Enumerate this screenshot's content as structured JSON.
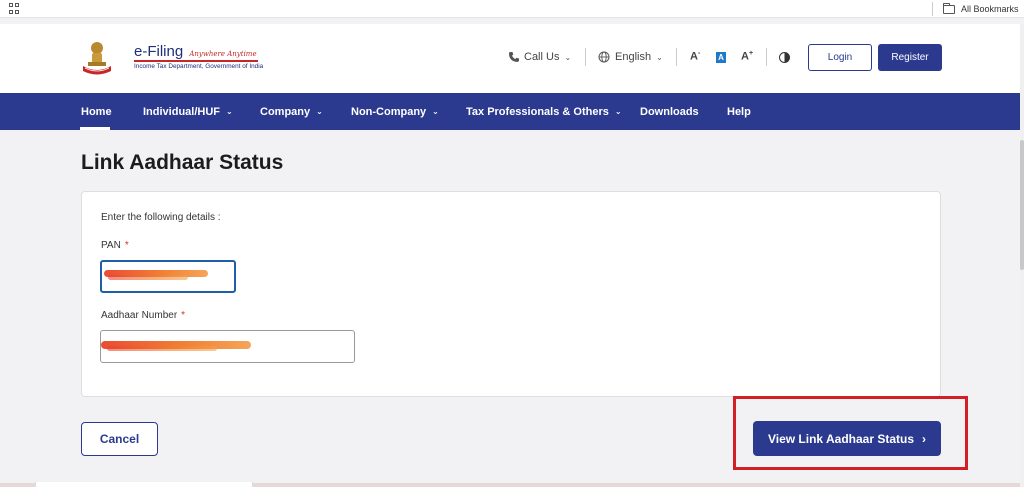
{
  "bookmarks_bar": {
    "all_bookmarks": "All Bookmarks"
  },
  "header": {
    "brand": "e-Filing",
    "tagline": "Anywhere Anytime",
    "department": "Income Tax Department, Government of India",
    "call_us": "Call Us",
    "language": "English",
    "font_decrease": "A",
    "font_default": "A",
    "font_increase": "A",
    "login": "Login",
    "register": "Register"
  },
  "nav": {
    "items": [
      {
        "label": "Home",
        "active": true
      },
      {
        "label": "Individual/HUF",
        "dropdown": true
      },
      {
        "label": "Company",
        "dropdown": true
      },
      {
        "label": "Non-Company",
        "dropdown": true
      },
      {
        "label": "Tax Professionals & Others",
        "dropdown": true
      },
      {
        "label": "Downloads"
      },
      {
        "label": "Help"
      }
    ]
  },
  "page": {
    "title": "Link Aadhaar Status",
    "instructions": "Enter the following details :",
    "pan_label": "PAN",
    "aadhaar_label": "Aadhaar Number",
    "required_mark": "*",
    "pan_value": "",
    "aadhaar_value": ""
  },
  "actions": {
    "cancel": "Cancel",
    "view_status": "View Link Aadhaar Status"
  },
  "colors": {
    "brand_blue": "#2b3a8f",
    "highlight_red": "#d21f26",
    "required_red": "#d32f2f"
  }
}
